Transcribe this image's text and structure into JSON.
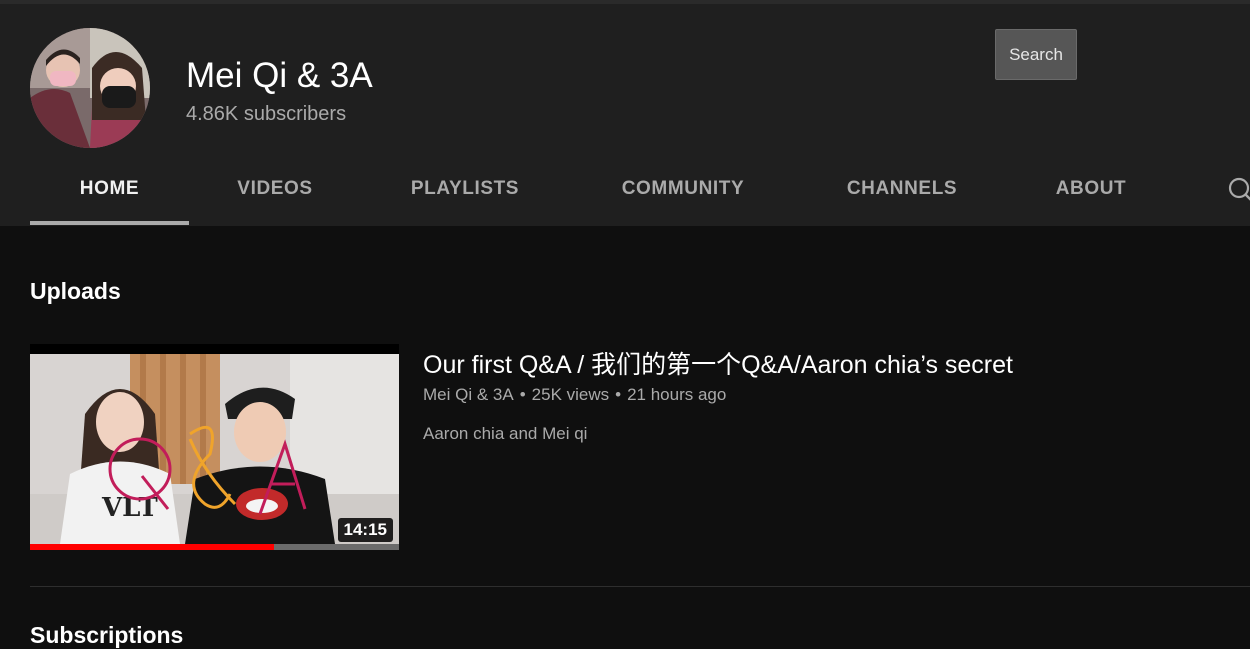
{
  "channel": {
    "name": "Mei Qi & 3A",
    "subscribers": "4.86K subscribers"
  },
  "header": {
    "search_label": "Search"
  },
  "tabs": [
    {
      "label": "HOME",
      "active": true
    },
    {
      "label": "VIDEOS",
      "active": false
    },
    {
      "label": "PLAYLISTS",
      "active": false
    },
    {
      "label": "COMMUNITY",
      "active": false
    },
    {
      "label": "CHANNELS",
      "active": false
    },
    {
      "label": "ABOUT",
      "active": false
    }
  ],
  "uploads": {
    "section_title": "Uploads",
    "video": {
      "title": "Our first Q&A / 我们的第一个Q&A/Aaron chia’s secret",
      "channel": "Mei Qi & 3A",
      "views": "25K views",
      "age": "21 hours ago",
      "description": "Aaron chia and Mei qi",
      "duration": "14:15",
      "watched_fraction": 0.66
    }
  },
  "next_section": {
    "title": "Subscriptions"
  },
  "colors": {
    "header_bg": "#1f1f1f",
    "page_bg": "#0f0f0f",
    "progress_red": "#ff0000"
  },
  "icons": {
    "tab_search": "search-icon"
  }
}
